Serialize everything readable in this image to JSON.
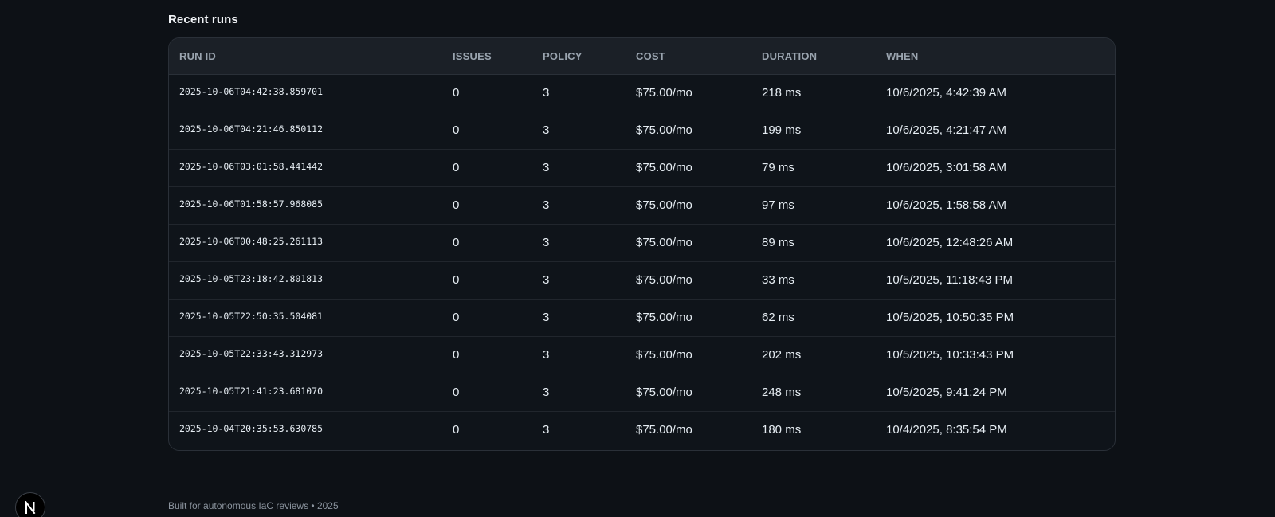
{
  "recent_runs": {
    "title": "Recent runs",
    "columns": [
      "RUN ID",
      "ISSUES",
      "POLICY",
      "COST",
      "DURATION",
      "WHEN"
    ],
    "rows": [
      {
        "run_id": "2025-10-06T04:42:38.859701",
        "issues": "0",
        "policy": "3",
        "cost": "$75.00/mo",
        "duration": "218 ms",
        "when": "10/6/2025, 4:42:39 AM"
      },
      {
        "run_id": "2025-10-06T04:21:46.850112",
        "issues": "0",
        "policy": "3",
        "cost": "$75.00/mo",
        "duration": "199 ms",
        "when": "10/6/2025, 4:21:47 AM"
      },
      {
        "run_id": "2025-10-06T03:01:58.441442",
        "issues": "0",
        "policy": "3",
        "cost": "$75.00/mo",
        "duration": "79 ms",
        "when": "10/6/2025, 3:01:58 AM"
      },
      {
        "run_id": "2025-10-06T01:58:57.968085",
        "issues": "0",
        "policy": "3",
        "cost": "$75.00/mo",
        "duration": "97 ms",
        "when": "10/6/2025, 1:58:58 AM"
      },
      {
        "run_id": "2025-10-06T00:48:25.261113",
        "issues": "0",
        "policy": "3",
        "cost": "$75.00/mo",
        "duration": "89 ms",
        "when": "10/6/2025, 12:48:26 AM"
      },
      {
        "run_id": "2025-10-05T23:18:42.801813",
        "issues": "0",
        "policy": "3",
        "cost": "$75.00/mo",
        "duration": "33 ms",
        "when": "10/5/2025, 11:18:43 PM"
      },
      {
        "run_id": "2025-10-05T22:50:35.504081",
        "issues": "0",
        "policy": "3",
        "cost": "$75.00/mo",
        "duration": "62 ms",
        "when": "10/5/2025, 10:50:35 PM"
      },
      {
        "run_id": "2025-10-05T22:33:43.312973",
        "issues": "0",
        "policy": "3",
        "cost": "$75.00/mo",
        "duration": "202 ms",
        "when": "10/5/2025, 10:33:43 PM"
      },
      {
        "run_id": "2025-10-05T21:41:23.681070",
        "issues": "0",
        "policy": "3",
        "cost": "$75.00/mo",
        "duration": "248 ms",
        "when": "10/5/2025, 9:41:24 PM"
      },
      {
        "run_id": "2025-10-04T20:35:53.630785",
        "issues": "0",
        "policy": "3",
        "cost": "$75.00/mo",
        "duration": "180 ms",
        "when": "10/4/2025, 8:35:54 PM"
      }
    ]
  },
  "footer": {
    "text": "Built for autonomous IaC reviews • 2025"
  },
  "dev_badge": {
    "letter": "N",
    "icon": "nextjs-logo-icon"
  },
  "colors": {
    "background": "#0d1116",
    "card_background": "#0f141a",
    "header_background": "#1b2027",
    "border": "#2a3038",
    "text_primary": "#e6edf3",
    "text_muted": "#9aa4af"
  }
}
